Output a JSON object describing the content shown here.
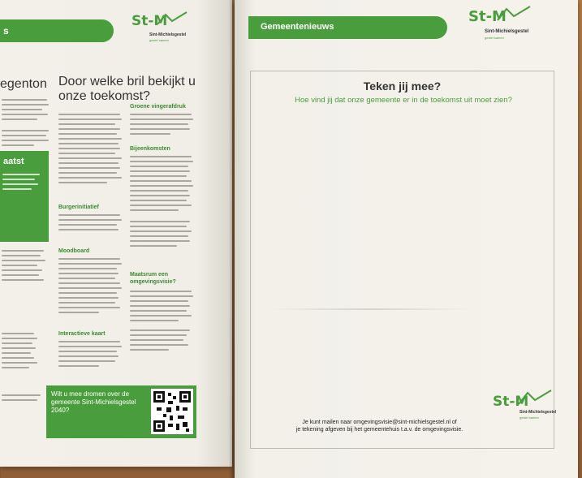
{
  "left_page": {
    "header_label": "Gemeentenieuws",
    "header_label_visible": "s",
    "logo": {
      "brand": "St-M",
      "name": "Sint-Michielsgestel",
      "tagline": "gestel samen"
    },
    "partial_heading": "egenton",
    "article_title": "Door welke bril bekijkt u onze toekomst?",
    "subheadings": [
      "Groene vingerafdruk",
      "Bijeenkomsten",
      "Burgerinitiatief",
      "Moodboard",
      "Maatsrum een omgevingsvisie?",
      "Interactieve kaart"
    ],
    "green_block_label": "aatst",
    "cta_text": "Wilt u mee dromen over de gemeente Sint-Michielsgestel 2040?"
  },
  "right_page": {
    "header_label": "Gemeentenieuws",
    "logo": {
      "brand": "St-M",
      "name": "Sint-Michielsgestel",
      "tagline": "gestel samen"
    },
    "form_title": "Teken jij mee?",
    "form_subtitle": "Hoe vind jij dat onze gemeente er in de toekomst uit moet zien?",
    "form_footer_line1": "Je kunt mailen naar omgevingsvisie@sint-michielsgestel.nl of",
    "form_footer_line2": "je tekening afgeven bij het gemeentehuis t.a.v. de omgevingsvisie.",
    "form_logo": {
      "brand": "St-M",
      "name": "Sint-Michielsgestel",
      "tagline": "gestel samen"
    }
  },
  "colors": {
    "brand_green": "#4a9d3c",
    "paper": "#f3f1ea",
    "table": "#9b6b3f"
  }
}
